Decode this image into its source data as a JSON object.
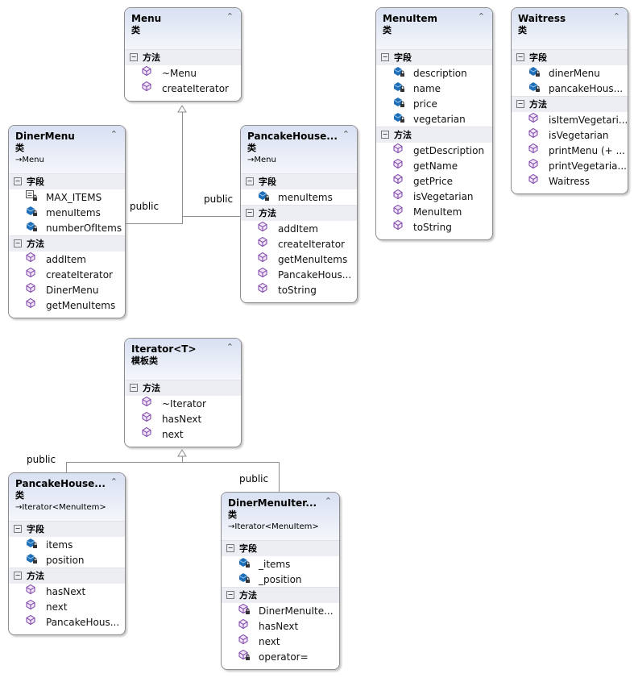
{
  "connector_label": "public",
  "kind_label": "类",
  "fields_label": "字段",
  "methods_label": "方法",
  "colors": {
    "field": "#1f6fb8",
    "method": "#7b3fa8",
    "header": "#d8e0f2"
  },
  "boxes": [
    {
      "id": "menu",
      "title": "Menu",
      "kind": "类",
      "sections": [
        {
          "label": "方法",
          "items": [
            {
              "name": "~Menu",
              "icon": "method"
            },
            {
              "name": "createIterator",
              "icon": "method"
            }
          ]
        }
      ]
    },
    {
      "id": "menuitem",
      "title": "MenuItem",
      "kind": "类",
      "sections": [
        {
          "label": "字段",
          "items": [
            {
              "name": "description",
              "icon": "field-private"
            },
            {
              "name": "name",
              "icon": "field-private"
            },
            {
              "name": "price",
              "icon": "field-private"
            },
            {
              "name": "vegetarian",
              "icon": "field-private"
            }
          ]
        },
        {
          "label": "方法",
          "items": [
            {
              "name": "getDescription",
              "icon": "method"
            },
            {
              "name": "getName",
              "icon": "method"
            },
            {
              "name": "getPrice",
              "icon": "method"
            },
            {
              "name": "isVegetarian",
              "icon": "method"
            },
            {
              "name": "MenuItem",
              "icon": "method"
            },
            {
              "name": "toString",
              "icon": "method"
            }
          ]
        }
      ]
    },
    {
      "id": "waitress",
      "title": "Waitress",
      "kind": "类",
      "sections": [
        {
          "label": "字段",
          "items": [
            {
              "name": "dinerMenu",
              "icon": "field-private"
            },
            {
              "name": "pancakeHous...",
              "icon": "field-private"
            }
          ]
        },
        {
          "label": "方法",
          "items": [
            {
              "name": "isItemVegetari...",
              "icon": "method"
            },
            {
              "name": "isVegetarian",
              "icon": "method"
            },
            {
              "name": "printMenu (+ ...",
              "icon": "method"
            },
            {
              "name": "printVegetaria...",
              "icon": "method"
            },
            {
              "name": "Waitress",
              "icon": "method"
            }
          ]
        }
      ]
    },
    {
      "id": "dinermenu",
      "title": "DinerMenu",
      "kind": "类",
      "base": "Menu",
      "sections": [
        {
          "label": "字段",
          "items": [
            {
              "name": "MAX_ITEMS",
              "icon": "const-private"
            },
            {
              "name": "menuItems",
              "icon": "field-private"
            },
            {
              "name": "numberOfItems",
              "icon": "field-private"
            }
          ]
        },
        {
          "label": "方法",
          "items": [
            {
              "name": "addItem",
              "icon": "method"
            },
            {
              "name": "createIterator",
              "icon": "method"
            },
            {
              "name": "DinerMenu",
              "icon": "method"
            },
            {
              "name": "getMenuItems",
              "icon": "method"
            }
          ]
        }
      ]
    },
    {
      "id": "pancakehouse",
      "title": "PancakeHouse...",
      "kind": "类",
      "base": "Menu",
      "sections": [
        {
          "label": "字段",
          "items": [
            {
              "name": "menuItems",
              "icon": "field-private"
            }
          ]
        },
        {
          "label": "方法",
          "items": [
            {
              "name": "addItem",
              "icon": "method"
            },
            {
              "name": "createIterator",
              "icon": "method"
            },
            {
              "name": "getMenuItems",
              "icon": "method"
            },
            {
              "name": "PancakeHous...",
              "icon": "method"
            },
            {
              "name": "toString",
              "icon": "method"
            }
          ]
        }
      ]
    },
    {
      "id": "iterator",
      "title": "Iterator<T>",
      "kind": "模板类",
      "sections": [
        {
          "label": "方法",
          "items": [
            {
              "name": "~Iterator",
              "icon": "method"
            },
            {
              "name": "hasNext",
              "icon": "method"
            },
            {
              "name": "next",
              "icon": "method"
            }
          ]
        }
      ]
    },
    {
      "id": "pancakeiter",
      "title": "PancakeHouse...",
      "kind": "类",
      "base": "Iterator<MenuItem>",
      "sections": [
        {
          "label": "字段",
          "items": [
            {
              "name": "items",
              "icon": "field-private"
            },
            {
              "name": "position",
              "icon": "field-private"
            }
          ]
        },
        {
          "label": "方法",
          "items": [
            {
              "name": "hasNext",
              "icon": "method"
            },
            {
              "name": "next",
              "icon": "method"
            },
            {
              "name": "PancakeHous...",
              "icon": "method"
            }
          ]
        }
      ]
    },
    {
      "id": "dineriter",
      "title": "DinerMenuIter...",
      "kind": "类",
      "base": "Iterator<MenuItem>",
      "sections": [
        {
          "label": "字段",
          "items": [
            {
              "name": "_items",
              "icon": "field-private"
            },
            {
              "name": "_position",
              "icon": "field-private"
            }
          ]
        },
        {
          "label": "方法",
          "items": [
            {
              "name": "DinerMenuIte...",
              "icon": "method-private"
            },
            {
              "name": "hasNext",
              "icon": "method"
            },
            {
              "name": "next",
              "icon": "method"
            },
            {
              "name": "operator=",
              "icon": "method-private"
            }
          ]
        }
      ]
    }
  ]
}
